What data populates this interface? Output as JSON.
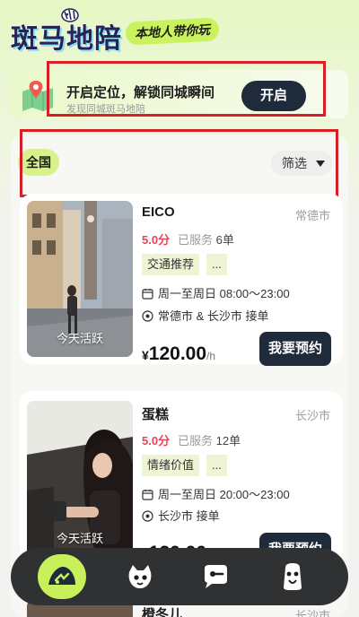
{
  "header": {
    "logo_text": "斑马地陪",
    "slogan": "本地人带你玩"
  },
  "location_banner": {
    "title": "开启定位，解锁同城瞬间",
    "subtitle": "发现同城斑马地陪",
    "button_label": "开启"
  },
  "filter_bar": {
    "region_tab": "全国",
    "filter_label": "筛选"
  },
  "cards": [
    {
      "name": "EICO",
      "city": "常德市",
      "score": "5.0分",
      "served_prefix": "已服务",
      "served_count": "6单",
      "tag": "交通推荐",
      "tag_more": "...",
      "schedule": "周一至周日 08:00～23:00",
      "area": "常德市 & 长沙市 接单",
      "currency": "¥",
      "price": "120.00",
      "unit": "/h",
      "book_label": "我要预约",
      "photo_label": "今天活跃"
    },
    {
      "name": "蛋糕",
      "city": "长沙市",
      "score": "5.0分",
      "served_prefix": "已服务",
      "served_count": "12单",
      "tag": "情绪价值",
      "tag_more": "...",
      "schedule": "周一至周日 20:00～23:00",
      "area": "长沙市 接单",
      "currency": "¥",
      "price": "120.00",
      "unit": "/h",
      "book_label": "我要预约",
      "photo_label": "今天活跃"
    }
  ],
  "next_card": {
    "name": "橙冬儿",
    "city": "长沙市"
  },
  "bottom_nav": {
    "items": [
      "home-icon",
      "cat-icon",
      "message-icon",
      "profile-icon"
    ],
    "active_color": "#c8f05a"
  },
  "colors": {
    "accent_green": "#c9f25e",
    "dark_button": "#1f2a3a",
    "score_red": "#e8435a",
    "highlight_red": "#d61f26"
  }
}
